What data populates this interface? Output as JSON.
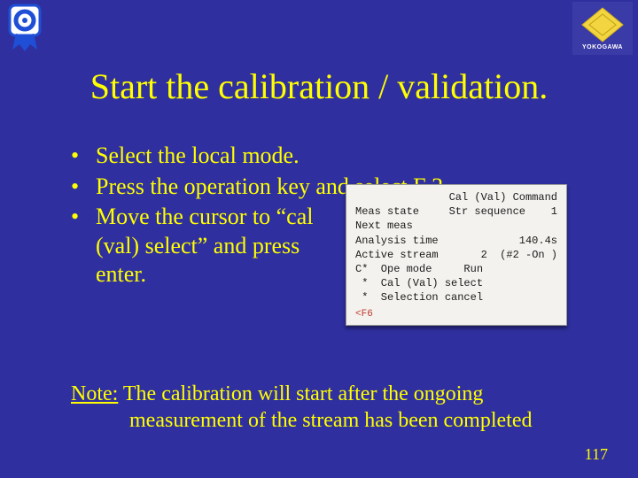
{
  "logos": {
    "badge_name": "certification-badge-icon",
    "yokogawa_name": "yokogawa-logo",
    "yokogawa_text": "YOKOGAWA"
  },
  "title": "Start the calibration / validation.",
  "bullets": {
    "mark": "•",
    "items": [
      "Select the local mode.",
      "Press the operation key and select F 2.",
      "Move the cursor to “cal (val) select” and press enter."
    ]
  },
  "device": {
    "header_left": "",
    "header_right": "Cal (Val) Command",
    "rows": [
      {
        "label": "Meas state",
        "value": "Str sequence    1"
      },
      {
        "label": "Next meas",
        "value": ""
      },
      {
        "label": "Analysis time",
        "value": "140.4s"
      },
      {
        "label": "Active stream",
        "value": "2  (#2 -On )"
      }
    ],
    "modes": [
      "C*  Ope mode     Run",
      " *  Cal (Val) select",
      " *  Selection cancel"
    ],
    "footer_left": "<F6",
    "footer_right": ""
  },
  "note": {
    "label": "Note:",
    "line1": " The calibration will start after the ongoing",
    "line2": "measurement of the stream has been completed"
  },
  "page_number": "117"
}
